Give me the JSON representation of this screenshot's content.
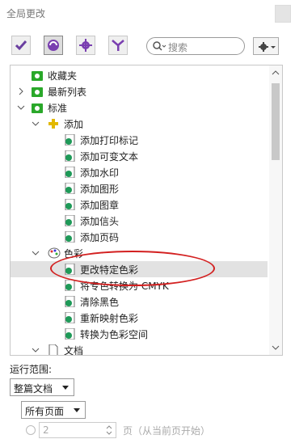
{
  "panel": {
    "title": "全局更改"
  },
  "toolbar": {
    "search_placeholder": "搜索"
  },
  "tree": {
    "items": [
      {
        "label": "收藏夹"
      },
      {
        "label": "最新列表"
      },
      {
        "label": "标准"
      },
      {
        "label": "添加"
      },
      {
        "label": "添加打印标记"
      },
      {
        "label": "添加可变文本"
      },
      {
        "label": "添加水印"
      },
      {
        "label": "添加图形"
      },
      {
        "label": "添加图章"
      },
      {
        "label": "添加信头"
      },
      {
        "label": "添加页码"
      },
      {
        "label": "色彩"
      },
      {
        "label": "更改特定色彩"
      },
      {
        "label": "将专色转换为 CMYK"
      },
      {
        "label": "清除黑色"
      },
      {
        "label": "重新映射色彩"
      },
      {
        "label": "转换为色彩空间"
      },
      {
        "label": "文档"
      }
    ]
  },
  "scope": {
    "label": "运行范围:",
    "document_select": "整篇文档",
    "pages_select": "所有页面",
    "page_number": "2",
    "page_hint": "页（从当前页开始）"
  },
  "colors": {
    "accent_green": "#2aa82a",
    "highlight_red": "#d32020"
  }
}
